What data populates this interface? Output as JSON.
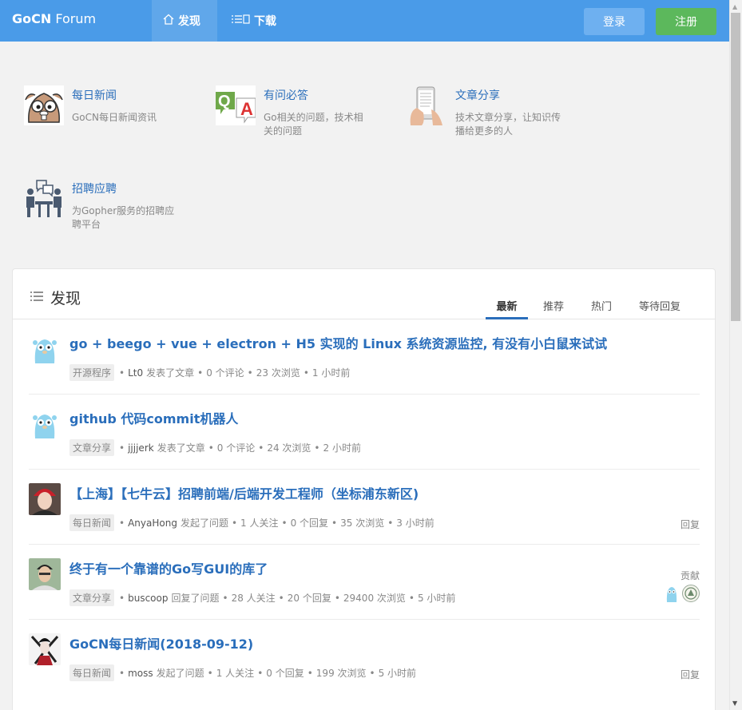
{
  "header": {
    "brand_bold": "GoCN",
    "brand_light": " Forum",
    "nav": [
      {
        "icon": "home-icon",
        "label": "发现"
      },
      {
        "icon": "list-icon",
        "label": "下载"
      }
    ],
    "login_label": "登录",
    "register_label": "注册"
  },
  "categories": [
    {
      "title": "每日新闻",
      "desc": "GoCN每日新闻资讯",
      "icon": "gopher-news-icon"
    },
    {
      "title": "有问必答",
      "desc": "Go相关的问题，技术相关的问题",
      "icon": "qa-icon"
    },
    {
      "title": "文章分享",
      "desc": "技术文章分享，让知识传播给更多的人",
      "icon": "phone-article-icon"
    },
    {
      "title": "招聘应聘",
      "desc": "为Gopher服务的招聘应聘平台",
      "icon": "job-icon"
    }
  ],
  "feed": {
    "title": "发现",
    "tabs": [
      "最新",
      "推荐",
      "热门",
      "等待回复"
    ],
    "active_tab": "最新",
    "items": [
      {
        "title": "go + beego + vue + electron + H5 实现的 Linux 系统资源监控, 有没有小白鼠来试试",
        "tag": "开源程序",
        "user": "Lt0",
        "action": "发表了文章",
        "stats": [
          "0 个评论",
          "23 次浏览",
          "1 小时前"
        ],
        "side": ""
      },
      {
        "title": "github 代码commit机器人",
        "tag": "文章分享",
        "user": "jjjjerk",
        "action": "发表了文章",
        "stats": [
          "0 个评论",
          "24 次浏览",
          "2 小时前"
        ],
        "side": ""
      },
      {
        "title": "【上海】【七牛云】招聘前端/后端开发工程师（坐标浦东新区)",
        "tag": "每日新闻",
        "user": "AnyaHong",
        "action": "发起了问题",
        "stats": [
          "1 人关注",
          "0 个回复",
          "35 次浏览",
          "3 小时前"
        ],
        "side": "回复"
      },
      {
        "title": "终于有一个靠谱的Go写GUI的库了",
        "tag": "文章分享",
        "user": "buscoop",
        "action": "回复了问题",
        "stats": [
          "28 人关注",
          "20 个回复",
          "29400 次浏览",
          "5 小时前"
        ],
        "side": "贡献"
      },
      {
        "title": "GoCN每日新闻(2018-09-12)",
        "tag": "每日新闻",
        "user": "moss",
        "action": "发起了问题",
        "stats": [
          "1 人关注",
          "0 个回复",
          "199 次浏览",
          "5 小时前"
        ],
        "side": "回复"
      }
    ]
  },
  "colors": {
    "header": "#4a9be8",
    "link": "#2a6ebb",
    "register": "#5cb85c"
  }
}
